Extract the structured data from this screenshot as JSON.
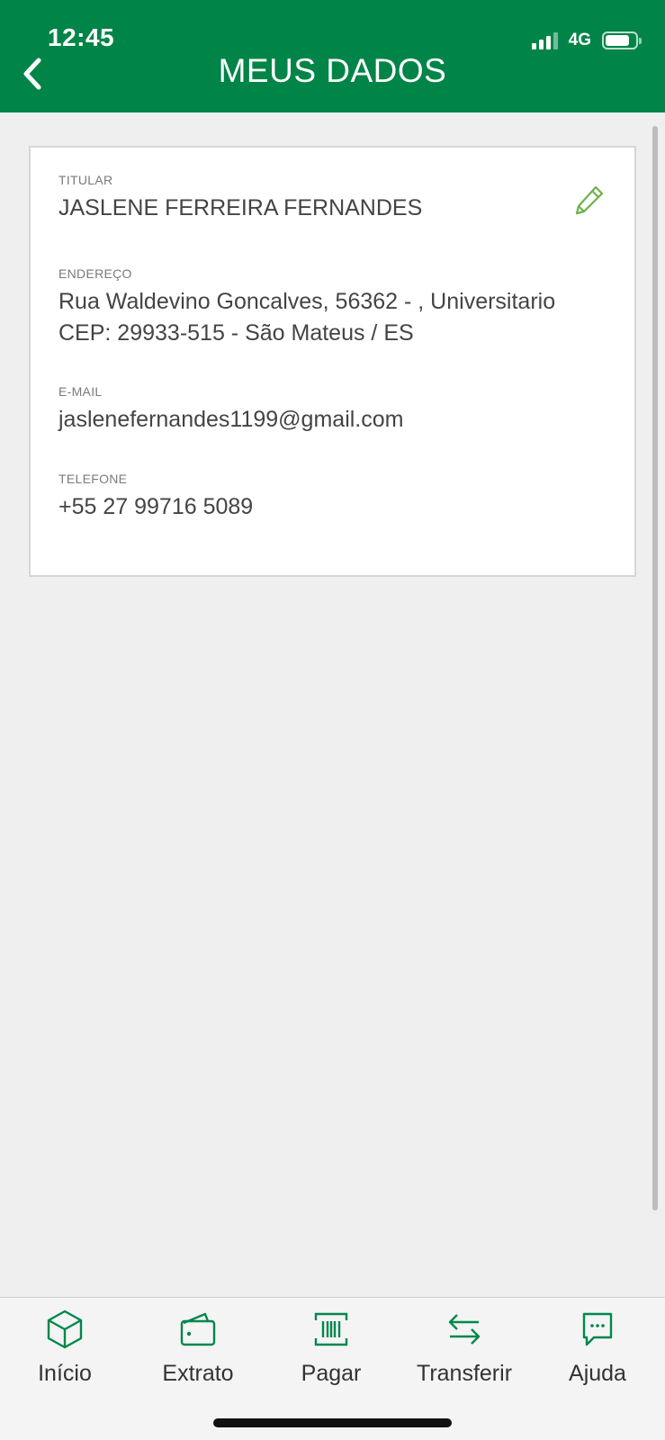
{
  "status_bar": {
    "time": "12:45",
    "network": "4G",
    "battery_level": 0.8
  },
  "header": {
    "title": "MEUS DADOS",
    "back_icon": "chevron-left-icon"
  },
  "card": {
    "edit_icon": "pencil-icon",
    "titular": {
      "label": "TITULAR",
      "value": "JASLENE FERREIRA FERNANDES"
    },
    "endereco": {
      "label": "ENDEREÇO",
      "line1": "Rua Waldevino Goncalves, 56362 - , Universitario",
      "line2": "CEP: 29933-515 - São Mateus / ES"
    },
    "email": {
      "label": "E-MAIL",
      "value": "jaslenefernandes1199@gmail.com"
    },
    "telefone": {
      "label": "TELEFONE",
      "value": "+55 27 99716 5089"
    }
  },
  "tabbar": {
    "items": [
      {
        "label": "Início",
        "icon": "cube-icon"
      },
      {
        "label": "Extrato",
        "icon": "wallet-icon"
      },
      {
        "label": "Pagar",
        "icon": "barcode-icon"
      },
      {
        "label": "Transferir",
        "icon": "transfer-arrows-icon"
      },
      {
        "label": "Ajuda",
        "icon": "chat-bubble-icon"
      }
    ]
  },
  "colors": {
    "brand": "#008447",
    "icon_green": "#00874a",
    "edit_green": "#6cb24a",
    "background": "#efefef"
  }
}
